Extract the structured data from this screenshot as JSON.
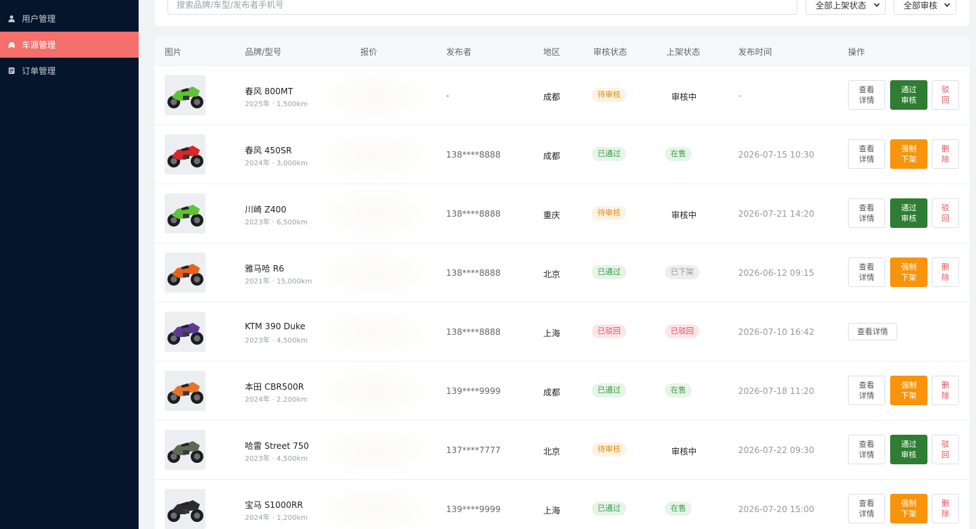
{
  "sidebar": {
    "items": [
      {
        "label": "用户管理",
        "icon": "user-icon",
        "active": false
      },
      {
        "label": "车源管理",
        "icon": "car-icon",
        "active": true
      },
      {
        "label": "订单管理",
        "icon": "order-icon",
        "active": false
      }
    ]
  },
  "filters": {
    "search_placeholder": "搜索品牌/车型/发布者手机号",
    "shelf_status_select": "全部上架状态",
    "audit_select": "全部审核"
  },
  "table": {
    "columns": [
      "图片",
      "品牌/型号",
      "报价",
      "发布者",
      "地区",
      "审核状态",
      "上架状态",
      "发布时间",
      "操作"
    ],
    "rows": [
      {
        "model": "春风 800MT",
        "sub": "2025年 · 1,500km",
        "publisher": "-",
        "region": "成都",
        "audit": "待审核",
        "audit_type": "pending",
        "shelf": "审核中",
        "shelf_type": "plain",
        "time": "-",
        "bike_color": "#5fc23a",
        "actions": {
          "view": "查看详情",
          "primary": "通过审核",
          "primary_type": "pass",
          "danger": "驳回"
        }
      },
      {
        "model": "春风 450SR",
        "sub": "2024年 · 3,000km",
        "publisher": "138****8888",
        "region": "成都",
        "audit": "已通过",
        "audit_type": "pass",
        "shelf": "在售",
        "shelf_type": "pass",
        "time": "2026-07-15 10:30",
        "bike_color": "#d9262b",
        "actions": {
          "view": "查看详情",
          "primary": "强制下架",
          "primary_type": "force",
          "danger": "删除"
        }
      },
      {
        "model": "川崎 Z400",
        "sub": "2023年 · 6,500km",
        "publisher": "138****8888",
        "region": "重庆",
        "audit": "待审核",
        "audit_type": "pending",
        "shelf": "审核中",
        "shelf_type": "plain",
        "time": "2026-07-21 14:20",
        "bike_color": "#5fc23a",
        "actions": {
          "view": "查看详情",
          "primary": "通过审核",
          "primary_type": "pass",
          "danger": "驳回"
        }
      },
      {
        "model": "雅马哈 R6",
        "sub": "2021年 · 15,000km",
        "publisher": "138****8888",
        "region": "北京",
        "audit": "已通过",
        "audit_type": "pass",
        "shelf": "已下架",
        "shelf_type": "off",
        "time": "2026-06-12 09:15",
        "bike_color": "#e7611d",
        "actions": {
          "view": "查看详情",
          "primary": "强制下架",
          "primary_type": "force",
          "danger": "删除"
        }
      },
      {
        "model": "KTM 390 Duke",
        "sub": "2023年 · 4,500km",
        "publisher": "138****8888",
        "region": "上海",
        "audit": "已驳回",
        "audit_type": "reject",
        "shelf": "已驳回",
        "shelf_type": "reject",
        "time": "2026-07-10 16:42",
        "bike_color": "#5b3a94",
        "actions": {
          "view": "查看详情"
        }
      },
      {
        "model": "本田 CBR500R",
        "sub": "2024年 · 2,200km",
        "publisher": "139****9999",
        "region": "成都",
        "audit": "已通过",
        "audit_type": "pass",
        "shelf": "在售",
        "shelf_type": "pass",
        "time": "2026-07-18 11:20",
        "bike_color": "#e2752a",
        "actions": {
          "view": "查看详情",
          "primary": "强制下架",
          "primary_type": "force",
          "danger": "删除"
        }
      },
      {
        "model": "哈雷 Street 750",
        "sub": "2023年 · 4,500km",
        "publisher": "137****7777",
        "region": "北京",
        "audit": "待审核",
        "audit_type": "pending",
        "shelf": "审核中",
        "shelf_type": "plain",
        "time": "2026-07-22 09:30",
        "bike_color": "#5d6b52",
        "actions": {
          "view": "查看详情",
          "primary": "通过审核",
          "primary_type": "pass",
          "danger": "驳回"
        }
      },
      {
        "model": "宝马 S1000RR",
        "sub": "2024年 · 1,200km",
        "publisher": "139****9999",
        "region": "上海",
        "audit": "已通过",
        "audit_type": "pass",
        "shelf": "在售",
        "shelf_type": "pass",
        "time": "2026-07-20 15:00",
        "bike_color": "#2b2b2e",
        "actions": {
          "view": "查看详情",
          "primary": "强制下架",
          "primary_type": "force",
          "danger": "删除"
        }
      }
    ]
  }
}
